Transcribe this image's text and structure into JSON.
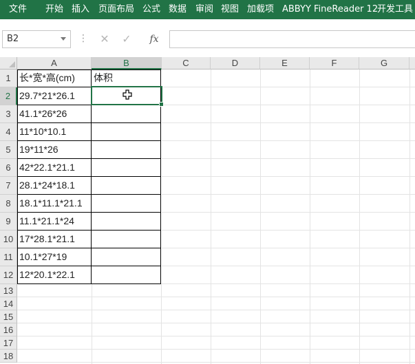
{
  "ribbon": {
    "tabs": [
      "文件",
      "开始",
      "插入",
      "页面布局",
      "公式",
      "数据",
      "审阅",
      "视图",
      "加载项",
      "ABBYY FineReader 12",
      "开发工具"
    ]
  },
  "formula_bar": {
    "name_box": "B2",
    "cancel_icon": "close-icon",
    "enter_icon": "check-icon",
    "fx_label": "fx",
    "formula": ""
  },
  "sheet": {
    "columns": [
      "A",
      "B",
      "C",
      "D",
      "E",
      "F",
      "G"
    ],
    "rows": [
      "1",
      "2",
      "3",
      "4",
      "5",
      "6",
      "7",
      "8",
      "9",
      "10",
      "11",
      "12",
      "13",
      "14",
      "15",
      "16",
      "17",
      "18"
    ],
    "selected_cell": "B2",
    "header_A1": "长*宽*高(cm)",
    "header_B1": "体积",
    "col_a": [
      "29.7*21*26.1",
      "41.1*26*26",
      "11*10*10.1",
      "19*11*26",
      "42*22.1*21.1",
      "28.1*24*18.1",
      "18.1*11.1*21.1",
      "11.1*21.1*24",
      "17*28.1*21.1",
      "10.1*27*19",
      "12*20.1*22.1"
    ],
    "col_b": [
      "",
      "",
      "",
      "",
      "",
      "",
      "",
      "",
      "",
      "",
      ""
    ]
  },
  "colors": {
    "accent": "#217346",
    "header_bg": "#e9e9e9",
    "grid": "#e3e3e3"
  }
}
